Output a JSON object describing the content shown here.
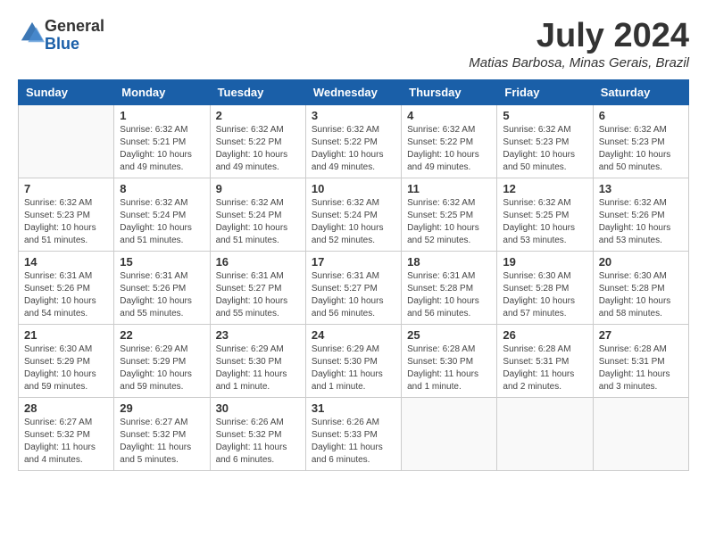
{
  "logo": {
    "general": "General",
    "blue": "Blue"
  },
  "title": {
    "month_year": "July 2024",
    "location": "Matias Barbosa, Minas Gerais, Brazil"
  },
  "headers": [
    "Sunday",
    "Monday",
    "Tuesday",
    "Wednesday",
    "Thursday",
    "Friday",
    "Saturday"
  ],
  "weeks": [
    [
      {
        "day": "",
        "info": ""
      },
      {
        "day": "1",
        "info": "Sunrise: 6:32 AM\nSunset: 5:21 PM\nDaylight: 10 hours\nand 49 minutes."
      },
      {
        "day": "2",
        "info": "Sunrise: 6:32 AM\nSunset: 5:22 PM\nDaylight: 10 hours\nand 49 minutes."
      },
      {
        "day": "3",
        "info": "Sunrise: 6:32 AM\nSunset: 5:22 PM\nDaylight: 10 hours\nand 49 minutes."
      },
      {
        "day": "4",
        "info": "Sunrise: 6:32 AM\nSunset: 5:22 PM\nDaylight: 10 hours\nand 49 minutes."
      },
      {
        "day": "5",
        "info": "Sunrise: 6:32 AM\nSunset: 5:23 PM\nDaylight: 10 hours\nand 50 minutes."
      },
      {
        "day": "6",
        "info": "Sunrise: 6:32 AM\nSunset: 5:23 PM\nDaylight: 10 hours\nand 50 minutes."
      }
    ],
    [
      {
        "day": "7",
        "info": "Sunrise: 6:32 AM\nSunset: 5:23 PM\nDaylight: 10 hours\nand 51 minutes."
      },
      {
        "day": "8",
        "info": "Sunrise: 6:32 AM\nSunset: 5:24 PM\nDaylight: 10 hours\nand 51 minutes."
      },
      {
        "day": "9",
        "info": "Sunrise: 6:32 AM\nSunset: 5:24 PM\nDaylight: 10 hours\nand 51 minutes."
      },
      {
        "day": "10",
        "info": "Sunrise: 6:32 AM\nSunset: 5:24 PM\nDaylight: 10 hours\nand 52 minutes."
      },
      {
        "day": "11",
        "info": "Sunrise: 6:32 AM\nSunset: 5:25 PM\nDaylight: 10 hours\nand 52 minutes."
      },
      {
        "day": "12",
        "info": "Sunrise: 6:32 AM\nSunset: 5:25 PM\nDaylight: 10 hours\nand 53 minutes."
      },
      {
        "day": "13",
        "info": "Sunrise: 6:32 AM\nSunset: 5:26 PM\nDaylight: 10 hours\nand 53 minutes."
      }
    ],
    [
      {
        "day": "14",
        "info": "Sunrise: 6:31 AM\nSunset: 5:26 PM\nDaylight: 10 hours\nand 54 minutes."
      },
      {
        "day": "15",
        "info": "Sunrise: 6:31 AM\nSunset: 5:26 PM\nDaylight: 10 hours\nand 55 minutes."
      },
      {
        "day": "16",
        "info": "Sunrise: 6:31 AM\nSunset: 5:27 PM\nDaylight: 10 hours\nand 55 minutes."
      },
      {
        "day": "17",
        "info": "Sunrise: 6:31 AM\nSunset: 5:27 PM\nDaylight: 10 hours\nand 56 minutes."
      },
      {
        "day": "18",
        "info": "Sunrise: 6:31 AM\nSunset: 5:28 PM\nDaylight: 10 hours\nand 56 minutes."
      },
      {
        "day": "19",
        "info": "Sunrise: 6:30 AM\nSunset: 5:28 PM\nDaylight: 10 hours\nand 57 minutes."
      },
      {
        "day": "20",
        "info": "Sunrise: 6:30 AM\nSunset: 5:28 PM\nDaylight: 10 hours\nand 58 minutes."
      }
    ],
    [
      {
        "day": "21",
        "info": "Sunrise: 6:30 AM\nSunset: 5:29 PM\nDaylight: 10 hours\nand 59 minutes."
      },
      {
        "day": "22",
        "info": "Sunrise: 6:29 AM\nSunset: 5:29 PM\nDaylight: 10 hours\nand 59 minutes."
      },
      {
        "day": "23",
        "info": "Sunrise: 6:29 AM\nSunset: 5:30 PM\nDaylight: 11 hours\nand 1 minute."
      },
      {
        "day": "24",
        "info": "Sunrise: 6:29 AM\nSunset: 5:30 PM\nDaylight: 11 hours\nand 1 minute."
      },
      {
        "day": "25",
        "info": "Sunrise: 6:28 AM\nSunset: 5:30 PM\nDaylight: 11 hours\nand 1 minute."
      },
      {
        "day": "26",
        "info": "Sunrise: 6:28 AM\nSunset: 5:31 PM\nDaylight: 11 hours\nand 2 minutes."
      },
      {
        "day": "27",
        "info": "Sunrise: 6:28 AM\nSunset: 5:31 PM\nDaylight: 11 hours\nand 3 minutes."
      }
    ],
    [
      {
        "day": "28",
        "info": "Sunrise: 6:27 AM\nSunset: 5:32 PM\nDaylight: 11 hours\nand 4 minutes."
      },
      {
        "day": "29",
        "info": "Sunrise: 6:27 AM\nSunset: 5:32 PM\nDaylight: 11 hours\nand 5 minutes."
      },
      {
        "day": "30",
        "info": "Sunrise: 6:26 AM\nSunset: 5:32 PM\nDaylight: 11 hours\nand 6 minutes."
      },
      {
        "day": "31",
        "info": "Sunrise: 6:26 AM\nSunset: 5:33 PM\nDaylight: 11 hours\nand 6 minutes."
      },
      {
        "day": "",
        "info": ""
      },
      {
        "day": "",
        "info": ""
      },
      {
        "day": "",
        "info": ""
      }
    ]
  ]
}
